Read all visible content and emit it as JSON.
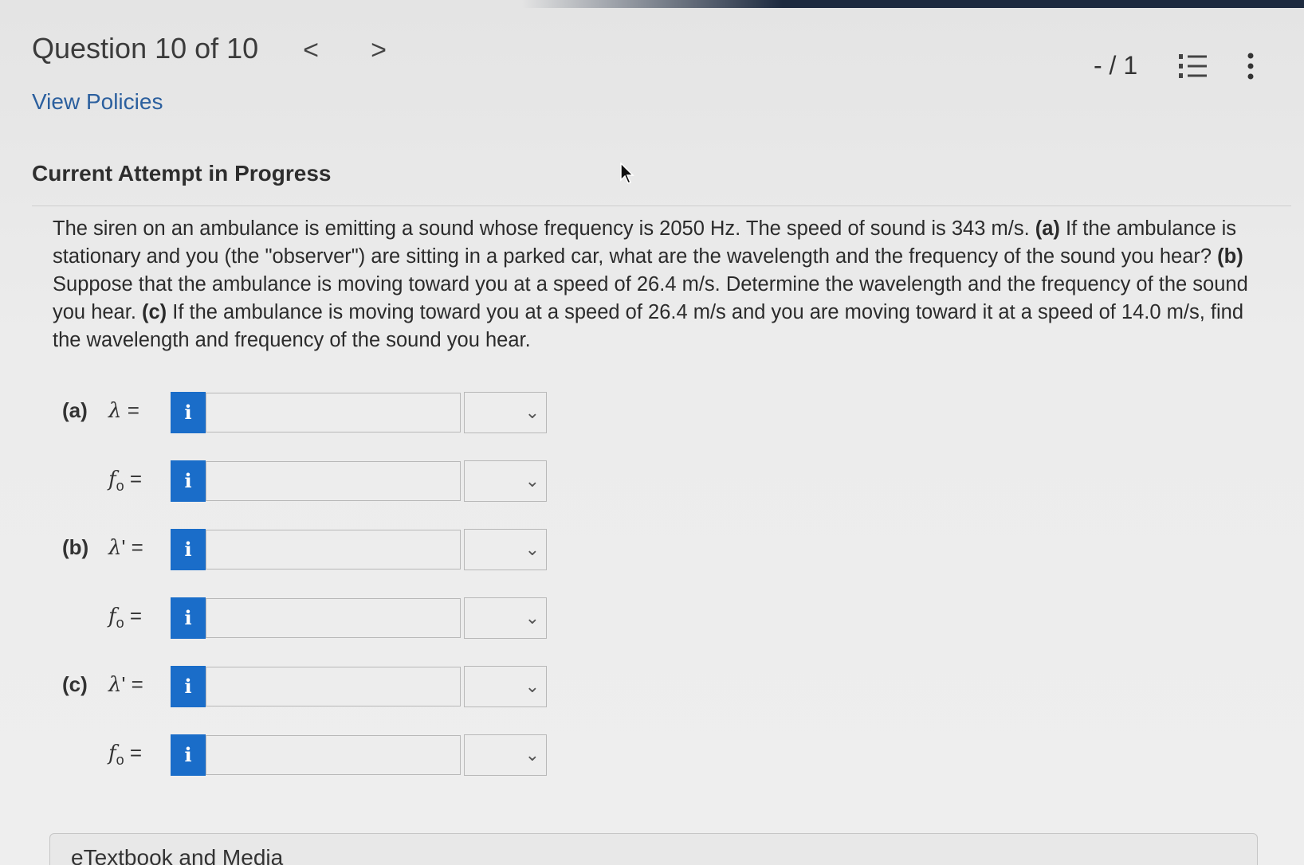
{
  "header": {
    "title": "Question 10 of 10",
    "prev_glyph": "<",
    "next_glyph": ">",
    "score": "- / 1",
    "list_icon": "list-numbered-icon",
    "more_icon": "vertical-ellipsis-icon"
  },
  "links": {
    "view_policies": "View Policies"
  },
  "attempt_status": "Current Attempt in Progress",
  "problem": {
    "p1": "The siren on an ambulance is emitting a sound whose frequency is 2050 Hz. The speed of sound is 343 m/s. ",
    "a_label": "(a)",
    "p2": " If the ambulance is stationary and you (the \"observer\") are sitting in a parked car, what are the wavelength and the frequency of the sound you hear? ",
    "b_label": "(b)",
    "p3": " Suppose that the ambulance is moving toward you at a speed of 26.4 m/s. Determine the wavelength and the frequency of the sound you hear. ",
    "c_label": "(c)",
    "p4": " If the ambulance is moving toward you at a speed of 26.4 m/s and you are moving toward it at a speed of 14.0 m/s, find the wavelength and frequency of the sound you hear."
  },
  "answers": [
    {
      "part": "(a)",
      "var": "λ",
      "suffix": " =",
      "sub": "",
      "input_value": "",
      "unit_value": ""
    },
    {
      "part": "",
      "var": "f",
      "suffix": " =",
      "sub": "o",
      "input_value": "",
      "unit_value": ""
    },
    {
      "part": "(b)",
      "var": "λ",
      "suffix": "' =",
      "sub": "",
      "input_value": "",
      "unit_value": ""
    },
    {
      "part": "",
      "var": "f",
      "suffix": " =",
      "sub": "o",
      "input_value": "",
      "unit_value": ""
    },
    {
      "part": "(c)",
      "var": "λ",
      "suffix": "' =",
      "sub": "",
      "input_value": "",
      "unit_value": ""
    },
    {
      "part": "",
      "var": "f",
      "suffix": " =",
      "sub": "o",
      "input_value": "",
      "unit_value": ""
    }
  ],
  "info_glyph": "i",
  "select_chevron": "⌄",
  "etextbook": "eTextbook and Media",
  "colors": {
    "link": "#2b5f9e",
    "info_button": "#1a6dc9",
    "top_bar": "#1d2a3f"
  }
}
